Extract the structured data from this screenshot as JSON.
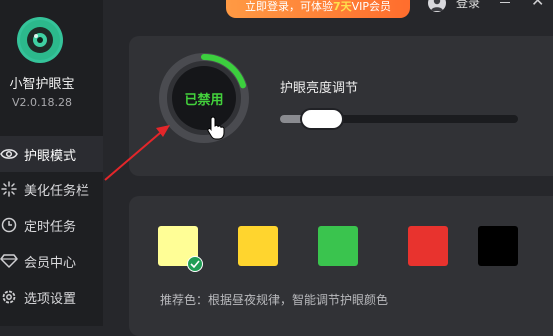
{
  "app": {
    "name": "小智护眼宝",
    "version": "V2.0.18.28"
  },
  "header": {
    "promo_prefix": "立即登录，可体验",
    "promo_highlight": "7天",
    "promo_suffix": "VIP会员",
    "login_label": "登录",
    "close_glyph": "✕"
  },
  "sidebar": {
    "items": [
      {
        "label": "护眼模式",
        "icon": "eye-icon",
        "active": true
      },
      {
        "label": "美化任务栏",
        "icon": "sparkle-icon",
        "active": false
      },
      {
        "label": "定时任务",
        "icon": "clock-icon",
        "active": false
      },
      {
        "label": "会员中心",
        "icon": "diamond-icon",
        "active": false
      },
      {
        "label": "选项设置",
        "icon": "gear-icon",
        "active": false
      }
    ]
  },
  "main": {
    "toggle_status": "已禁用",
    "brightness_label": "护眼亮度调节",
    "brightness_level": 0.12,
    "dial_progress": 0.2,
    "color_hint": "推荐色：根据昼夜规律，智能调节护眼颜色",
    "swatches": [
      {
        "name": "pale-yellow",
        "color": "#fffe96",
        "selected": true
      },
      {
        "name": "yellow",
        "color": "#ffd52e",
        "selected": false
      },
      {
        "name": "green",
        "color": "#3ac44e",
        "selected": false
      },
      {
        "name": "red",
        "color": "#e8332e",
        "selected": false
      },
      {
        "name": "black",
        "color": "#000000",
        "selected": false
      }
    ]
  },
  "colors": {
    "accent_green": "#43d13c",
    "annotation_red": "#e3262a",
    "promo_orange": "#ff7a2f"
  }
}
